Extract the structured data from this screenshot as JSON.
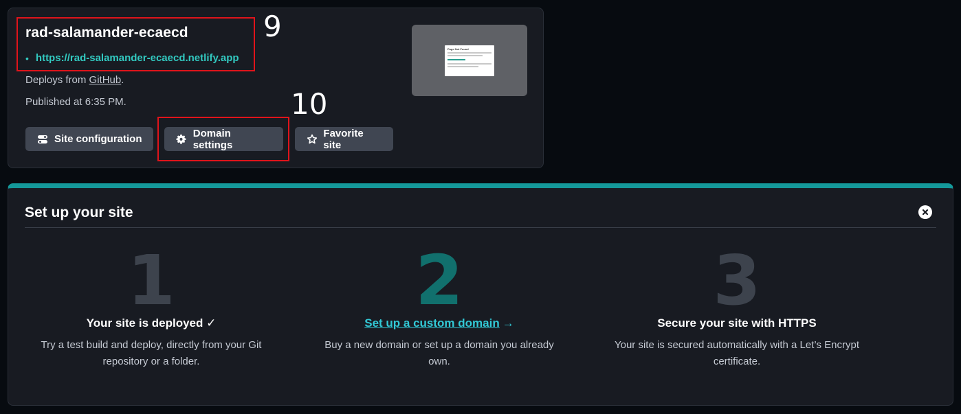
{
  "site": {
    "name": "rad-salamander-ecaecd",
    "url": "https://rad-salamander-ecaecd.netlify.app",
    "url_bullet": "•",
    "deploys_prefix": "Deploys from",
    "deploys_source": "GitHub",
    "deploys_suffix": ".",
    "published": "Published at 6:35 PM.",
    "buttons": {
      "config": "Site configuration",
      "domain": "Domain settings",
      "favorite": "Favorite site"
    },
    "thumbnail": {
      "title": "Page Not Found",
      "link": "← Back to our site"
    }
  },
  "annotations": {
    "box1_label": "9",
    "box2_label": "10",
    "color": "#e0141b"
  },
  "setup": {
    "title": "Set up your site",
    "accent_color": "#14999a",
    "steps": [
      {
        "number": "1",
        "title": "Your site is deployed",
        "title_suffix": "✓",
        "desc_line1": "Try a test build and deploy, directly from your Git",
        "desc_line2": "repository or a folder."
      },
      {
        "number": "2",
        "title": "Set up a custom domain",
        "title_suffix": "→",
        "desc_line1": "Buy a new domain or set up a domain you already",
        "desc_line2": "own."
      },
      {
        "number": "3",
        "title": "Secure your site with HTTPS",
        "title_suffix": "",
        "desc_line1": "Your site is secured automatically with a Let’s Encrypt",
        "desc_line2": "certificate."
      }
    ]
  }
}
